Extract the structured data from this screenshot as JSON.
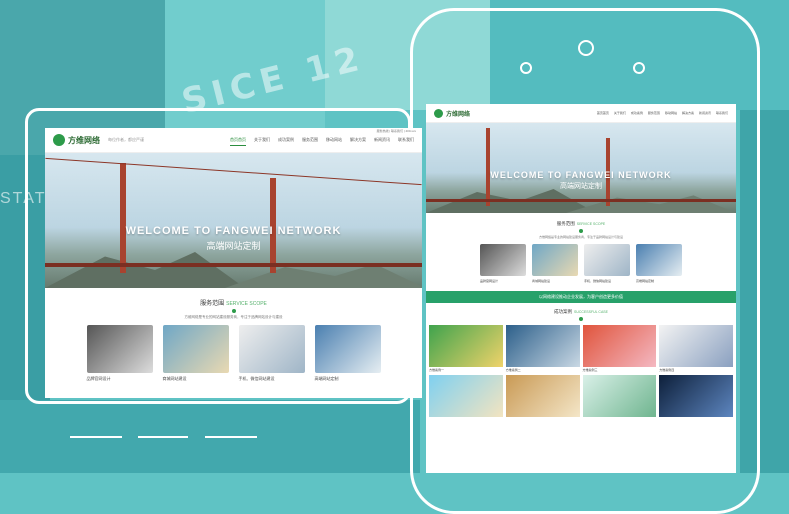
{
  "background": {
    "title_art": "SICE 12",
    "side_word": "STATU"
  },
  "site": {
    "logo_text": "方维网络",
    "slogan": "每位作者，都应严谨",
    "contact": "服务热线 | 联系我们 | 400-xxx",
    "nav": [
      "首页首页",
      "关于我们",
      "成功案例",
      "服务范围",
      "移动网站",
      "解决方案",
      "新闻资讯",
      "联系我们"
    ],
    "hero_title": "WELCOME TO FANGWEI NETWORK",
    "hero_sub": "高端网站定制",
    "section1_cn": "服务范围",
    "section1_en": "SERVICE SCOPE",
    "section1_desc": "方维网络是专业的网站建设服务商，专注于品牌网站设计与建设",
    "services": [
      "品牌官网设计",
      "商城网站建设",
      "手机、微信网站建设",
      "高端网站定制"
    ],
    "banner": "以网络建设推动企业发展，为客户创造更多价值",
    "section2_cn": "成功案例",
    "section2_en": "SUCCESSFUL CASE",
    "cases": [
      "方维案例一",
      "方维案例二",
      "方维案例三",
      "方维案例四"
    ]
  },
  "colors": {
    "teal_bg": "#5fc3c4",
    "brand_green": "#2d9b4a",
    "bridge_red": "#a8432f"
  }
}
